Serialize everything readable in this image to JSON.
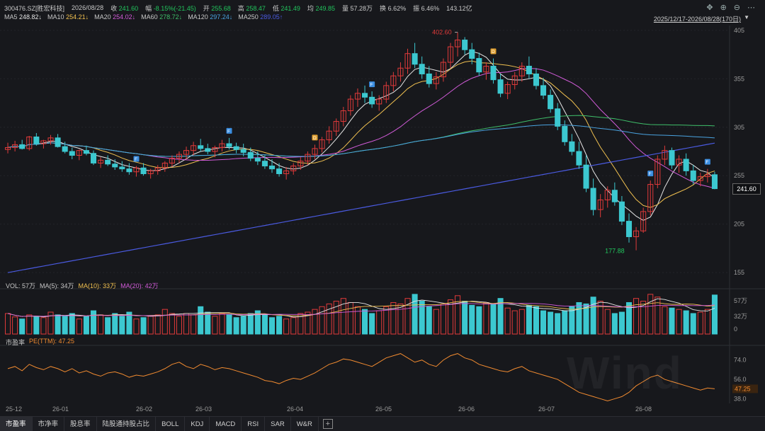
{
  "header": {
    "code": "300476.SZ[胜宏科技]",
    "date": "2026/08/28",
    "close_label": "收",
    "close": "241.60",
    "amp_label": "幅",
    "amp": "-8.15%(-21.45)",
    "open_label": "开",
    "open": "255.68",
    "high_label": "高",
    "high": "258.47",
    "low_label": "低",
    "low": "241.49",
    "avg_label": "均",
    "avg": "249.85",
    "vol_label": "量",
    "vol": "57.28万",
    "turn_label": "换",
    "turn": "6.62%",
    "swing_label": "振",
    "swing": "6.46%",
    "amount": "143.12亿",
    "range": "2025/12/17-2026/08/28(170日)"
  },
  "ma": [
    {
      "label": "MA5",
      "value": "248.82↓",
      "color": "#e6e6e6"
    },
    {
      "label": "MA10",
      "value": "254.21↓",
      "color": "#f0c050"
    },
    {
      "label": "MA20",
      "value": "254.02↓",
      "color": "#d15bd8"
    },
    {
      "label": "MA60",
      "value": "278.72↓",
      "color": "#3fbf6a"
    },
    {
      "label": "MA120",
      "value": "297.24↓",
      "color": "#4aa3e0"
    },
    {
      "label": "MA250",
      "value": "289.05↑",
      "color": "#4a5ae0"
    }
  ],
  "price_tag": "241.60",
  "vol_header": {
    "label": "VOL: 57万",
    "ma5": "MA(5): 34万",
    "ma10": "MA(10): 33万",
    "ma20": "MA(20): 42万"
  },
  "pe_header": {
    "label": "市盈率",
    "pe": "PE(TTM): 47.25"
  },
  "chart_data": {
    "type": "candlestick",
    "y_ticks": [
      405,
      355,
      305,
      255,
      205,
      155
    ],
    "y_range": [
      150,
      410
    ],
    "x_labels": [
      "25-12",
      "26-01",
      "26-02",
      "26-03",
      "26-04",
      "26-05",
      "26-06",
      "26-07",
      "26-08"
    ],
    "annotations": [
      {
        "text": "402.60",
        "kind": "high"
      },
      {
        "text": "177.88",
        "kind": "low"
      }
    ],
    "markers": [
      "F",
      "D",
      "F",
      "F",
      "F",
      "D",
      "F"
    ],
    "vol_ticks": [
      "57万",
      "32万",
      "0"
    ],
    "pe_ticks": [
      "74.0",
      "56.0",
      "38.0"
    ],
    "pe_last": "47.25",
    "candles": [
      [
        282,
        289,
        278,
        284
      ],
      [
        284,
        291,
        280,
        287
      ],
      [
        287,
        292,
        282,
        283
      ],
      [
        283,
        296,
        281,
        295
      ],
      [
        295,
        299,
        286,
        288
      ],
      [
        288,
        292,
        283,
        291
      ],
      [
        291,
        297,
        287,
        294
      ],
      [
        294,
        298,
        284,
        285
      ],
      [
        285,
        290,
        278,
        280
      ],
      [
        280,
        284,
        272,
        276
      ],
      [
        276,
        282,
        271,
        281
      ],
      [
        281,
        286,
        276,
        278
      ],
      [
        278,
        281,
        266,
        268
      ],
      [
        268,
        274,
        263,
        271
      ],
      [
        271,
        276,
        265,
        267
      ],
      [
        267,
        272,
        261,
        264
      ],
      [
        264,
        270,
        259,
        262
      ],
      [
        262,
        268,
        256,
        259
      ],
      [
        259,
        265,
        254,
        263
      ],
      [
        263,
        268,
        255,
        257
      ],
      [
        257,
        262,
        252,
        260
      ],
      [
        260,
        266,
        256,
        263
      ],
      [
        263,
        270,
        259,
        268
      ],
      [
        268,
        276,
        264,
        273
      ],
      [
        273,
        280,
        268,
        277
      ],
      [
        277,
        285,
        272,
        281
      ],
      [
        281,
        290,
        276,
        286
      ],
      [
        286,
        293,
        280,
        283
      ],
      [
        283,
        288,
        277,
        280
      ],
      [
        280,
        286,
        274,
        284
      ],
      [
        284,
        292,
        280,
        288
      ],
      [
        288,
        294,
        282,
        285
      ],
      [
        285,
        289,
        278,
        282
      ],
      [
        282,
        288,
        275,
        279
      ],
      [
        279,
        284,
        270,
        273
      ],
      [
        273,
        280,
        266,
        270
      ],
      [
        270,
        276,
        262,
        265
      ],
      [
        265,
        272,
        258,
        262
      ],
      [
        262,
        268,
        254,
        257
      ],
      [
        257,
        264,
        251,
        260
      ],
      [
        260,
        268,
        256,
        265
      ],
      [
        265,
        274,
        261,
        270
      ],
      [
        270,
        280,
        266,
        277
      ],
      [
        277,
        287,
        272,
        283
      ],
      [
        283,
        295,
        279,
        292
      ],
      [
        292,
        306,
        288,
        301
      ],
      [
        301,
        314,
        296,
        311
      ],
      [
        311,
        326,
        306,
        322
      ],
      [
        322,
        338,
        317,
        334
      ],
      [
        334,
        345,
        326,
        340
      ],
      [
        340,
        348,
        330,
        336
      ],
      [
        336,
        342,
        325,
        329
      ],
      [
        329,
        338,
        322,
        334
      ],
      [
        334,
        352,
        330,
        348
      ],
      [
        348,
        362,
        342,
        358
      ],
      [
        358,
        372,
        352,
        366
      ],
      [
        366,
        386,
        360,
        381
      ],
      [
        381,
        392,
        366,
        370
      ],
      [
        370,
        378,
        355,
        360
      ],
      [
        360,
        368,
        346,
        350
      ],
      [
        350,
        362,
        344,
        357
      ],
      [
        357,
        376,
        352,
        372
      ],
      [
        372,
        392,
        366,
        388
      ],
      [
        388,
        403,
        378,
        395
      ],
      [
        395,
        398,
        380,
        385
      ],
      [
        385,
        392,
        370,
        376
      ],
      [
        376,
        382,
        358,
        362
      ],
      [
        362,
        372,
        354,
        368
      ],
      [
        368,
        376,
        350,
        354
      ],
      [
        354,
        360,
        336,
        340
      ],
      [
        340,
        352,
        334,
        349
      ],
      [
        349,
        362,
        344,
        358
      ],
      [
        358,
        372,
        352,
        368
      ],
      [
        368,
        378,
        355,
        360
      ],
      [
        360,
        366,
        344,
        348
      ],
      [
        348,
        356,
        334,
        338
      ],
      [
        338,
        344,
        320,
        324
      ],
      [
        324,
        330,
        302,
        306
      ],
      [
        306,
        312,
        286,
        290
      ],
      [
        290,
        298,
        276,
        280
      ],
      [
        280,
        290,
        262,
        266
      ],
      [
        266,
        276,
        238,
        242
      ],
      [
        242,
        252,
        214,
        220
      ],
      [
        220,
        236,
        212,
        230
      ],
      [
        230,
        244,
        222,
        240
      ],
      [
        240,
        248,
        224,
        228
      ],
      [
        228,
        234,
        204,
        208
      ],
      [
        208,
        216,
        186,
        192
      ],
      [
        192,
        202,
        178,
        198
      ],
      [
        198,
        222,
        196,
        218
      ],
      [
        218,
        250,
        214,
        246
      ],
      [
        246,
        276,
        242,
        272
      ],
      [
        272,
        286,
        266,
        281
      ],
      [
        281,
        284,
        262,
        266
      ],
      [
        266,
        276,
        258,
        272
      ],
      [
        272,
        278,
        255,
        260
      ],
      [
        260,
        266,
        246,
        250
      ],
      [
        250,
        258,
        244,
        254
      ],
      [
        254,
        262,
        248,
        256
      ],
      [
        256,
        259,
        241,
        241.6
      ]
    ],
    "volumes": [
      30,
      25,
      22,
      28,
      26,
      24,
      32,
      28,
      26,
      30,
      22,
      26,
      34,
      28,
      24,
      30,
      26,
      32,
      22,
      24,
      26,
      28,
      36,
      30,
      26,
      30,
      28,
      40,
      32,
      26,
      30,
      28,
      24,
      26,
      30,
      34,
      28,
      24,
      26,
      22,
      24,
      30,
      32,
      36,
      40,
      44,
      48,
      52,
      46,
      40,
      36,
      30,
      34,
      40,
      46,
      44,
      52,
      58,
      48,
      40,
      36,
      44,
      50,
      56,
      48,
      42,
      40,
      46,
      44,
      52,
      38,
      34,
      36,
      42,
      40,
      34,
      32,
      30,
      34,
      40,
      46,
      44,
      54,
      48,
      36,
      30,
      32,
      46,
      52,
      48,
      58,
      54,
      40,
      38,
      36,
      34,
      30,
      32,
      36,
      57
    ],
    "pe_series": [
      66,
      68,
      64,
      70,
      67,
      65,
      68,
      66,
      63,
      66,
      62,
      64,
      61,
      59,
      62,
      63,
      61,
      58,
      60,
      59,
      61,
      63,
      66,
      70,
      72,
      68,
      66,
      70,
      68,
      65,
      67,
      66,
      64,
      62,
      60,
      58,
      55,
      54,
      52,
      55,
      57,
      56,
      59,
      62,
      66,
      70,
      72,
      75,
      74,
      72,
      70,
      68,
      72,
      76,
      78,
      80,
      76,
      72,
      74,
      70,
      68,
      74,
      78,
      80,
      76,
      74,
      70,
      68,
      66,
      64,
      63,
      66,
      68,
      64,
      62,
      60,
      58,
      56,
      52,
      48,
      44,
      42,
      40,
      38,
      36,
      38,
      40,
      44,
      50,
      54,
      58,
      60,
      56,
      54,
      52,
      50,
      48,
      46,
      48,
      47.25
    ]
  },
  "tabs": [
    "市盈率",
    "市净率",
    "股息率",
    "陆股通持股占比",
    "BOLL",
    "KDJ",
    "MACD",
    "RSI",
    "SAR",
    "W&R"
  ],
  "colors": {
    "up": "#e03a3a",
    "down": "#3cc8d0",
    "bg": "#17181c"
  }
}
